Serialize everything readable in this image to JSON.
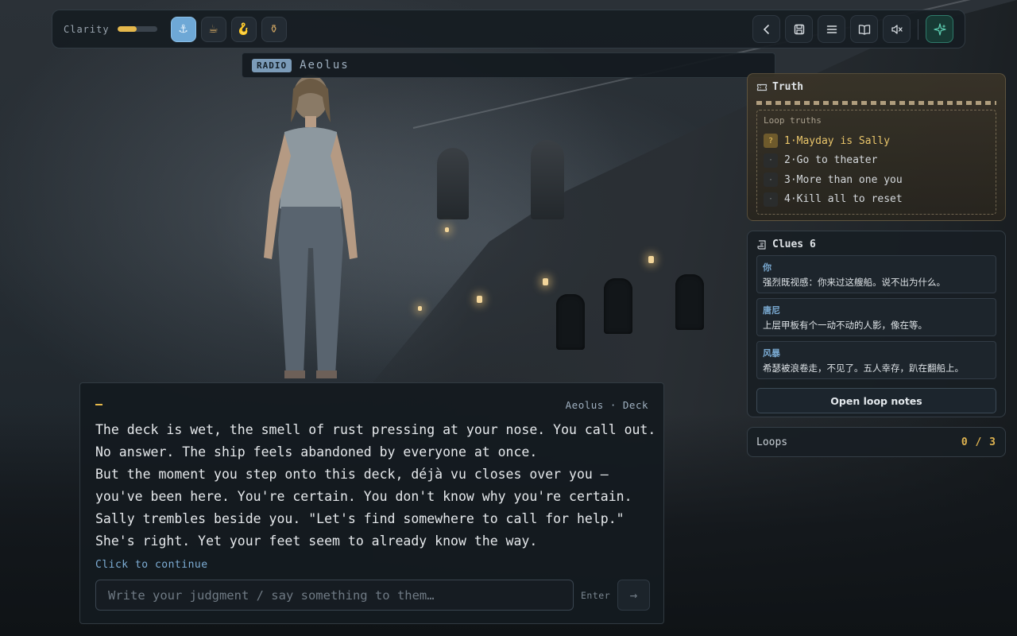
{
  "hud": {
    "clarity_label": "Clarity",
    "clarity_level": 0.48,
    "accent_color": "#e5b84c",
    "tools": [
      {
        "icon": "anchor-icon",
        "glyph": "⚓",
        "active": true
      },
      {
        "icon": "cup-icon",
        "glyph": "☕",
        "active": false
      },
      {
        "icon": "hook-icon",
        "glyph": "🪝",
        "active": false
      },
      {
        "icon": "jar-icon",
        "glyph": "⚱",
        "active": false
      }
    ],
    "right_buttons": [
      "back-icon",
      "save-icon",
      "menu-icon",
      "book-icon",
      "mute-icon",
      "sparkle-icon"
    ]
  },
  "radio": {
    "badge": "RADIO",
    "name": "Aeolus"
  },
  "truth": {
    "title": "Truth",
    "loop_title": "Loop truths",
    "items": [
      {
        "mark": "?",
        "text": "1·Mayday is Sally",
        "current": true
      },
      {
        "mark": "·",
        "text": "2·Go to theater",
        "current": false
      },
      {
        "mark": "·",
        "text": "3·More than one you",
        "current": false
      },
      {
        "mark": "·",
        "text": "4·Kill all to reset",
        "current": false
      }
    ]
  },
  "clues": {
    "title": "Clues 6",
    "items": [
      {
        "who": "你",
        "text": "强烈既视感：你来过这艘船。说不出为什么。"
      },
      {
        "who": "唐尼",
        "text": "上层甲板有个一动不动的人影，像在等。"
      },
      {
        "who": "风暴",
        "text": "希瑟被浪卷走，不见了。五人幸存，趴在翻船上。"
      }
    ],
    "notes_button": "Open loop notes"
  },
  "loops": {
    "label": "Loops",
    "count": "0 / 3"
  },
  "dialogue": {
    "location": "Aeolus · Deck",
    "lines": [
      "The deck is wet, the smell of rust pressing at your nose. You call out.",
      "No answer. The ship feels abandoned by everyone at once.",
      "But the moment you step onto this deck, déjà vu closes over you —",
      "you've been here. You're certain. You don't know why you're certain.",
      "Sally trembles beside you. \"Let's find somewhere to call for help.\"",
      "She's right. Yet your feet seem to already know the way."
    ],
    "continue_hint": "Click to continue",
    "input_placeholder": "Write your judgment / say something to them…",
    "input_value": "",
    "enter_label": "Enter",
    "send_icon": "arrow-right-icon"
  }
}
